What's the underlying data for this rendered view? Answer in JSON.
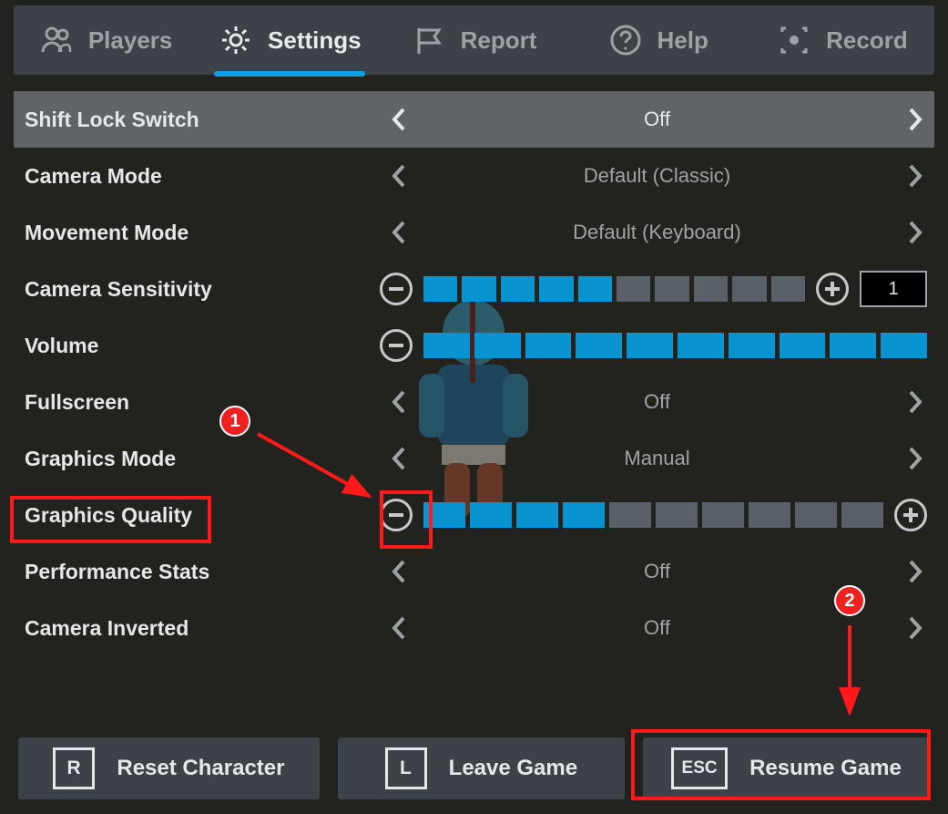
{
  "tabs": {
    "players": "Players",
    "settings": "Settings",
    "report": "Report",
    "help": "Help",
    "record": "Record"
  },
  "settings": {
    "rows": [
      {
        "id": "shift-lock",
        "label": "Shift Lock Switch",
        "type": "selector",
        "value": "Off",
        "highlighted": true
      },
      {
        "id": "camera-mode",
        "label": "Camera Mode",
        "type": "selector",
        "value": "Default (Classic)"
      },
      {
        "id": "movement",
        "label": "Movement Mode",
        "type": "selector",
        "value": "Default (Keyboard)"
      },
      {
        "id": "cam-sens",
        "label": "Camera Sensitivity",
        "type": "slider",
        "filled": 5,
        "total": 10,
        "numeric": "1",
        "show_number": true
      },
      {
        "id": "volume",
        "label": "Volume",
        "type": "slider",
        "filled": 10,
        "total": 10,
        "show_plus": false
      },
      {
        "id": "fullscreen",
        "label": "Fullscreen",
        "type": "selector",
        "value": "Off"
      },
      {
        "id": "gfx-mode",
        "label": "Graphics Mode",
        "type": "selector",
        "value": "Manual"
      },
      {
        "id": "gfx-quality",
        "label": "Graphics Quality",
        "type": "slider",
        "filled": 4,
        "total": 10,
        "show_plus": true
      },
      {
        "id": "perf-stats",
        "label": "Performance Stats",
        "type": "selector",
        "value": "Off"
      },
      {
        "id": "cam-inv",
        "label": "Camera Inverted",
        "type": "selector",
        "value": "Off"
      }
    ]
  },
  "bottom_buttons": {
    "reset": {
      "key": "R",
      "label": "Reset Character"
    },
    "leave": {
      "key": "L",
      "label": "Leave Game"
    },
    "resume": {
      "key": "ESC",
      "label": "Resume Game"
    }
  },
  "annotations": {
    "badge1": "1",
    "badge2": "2"
  }
}
